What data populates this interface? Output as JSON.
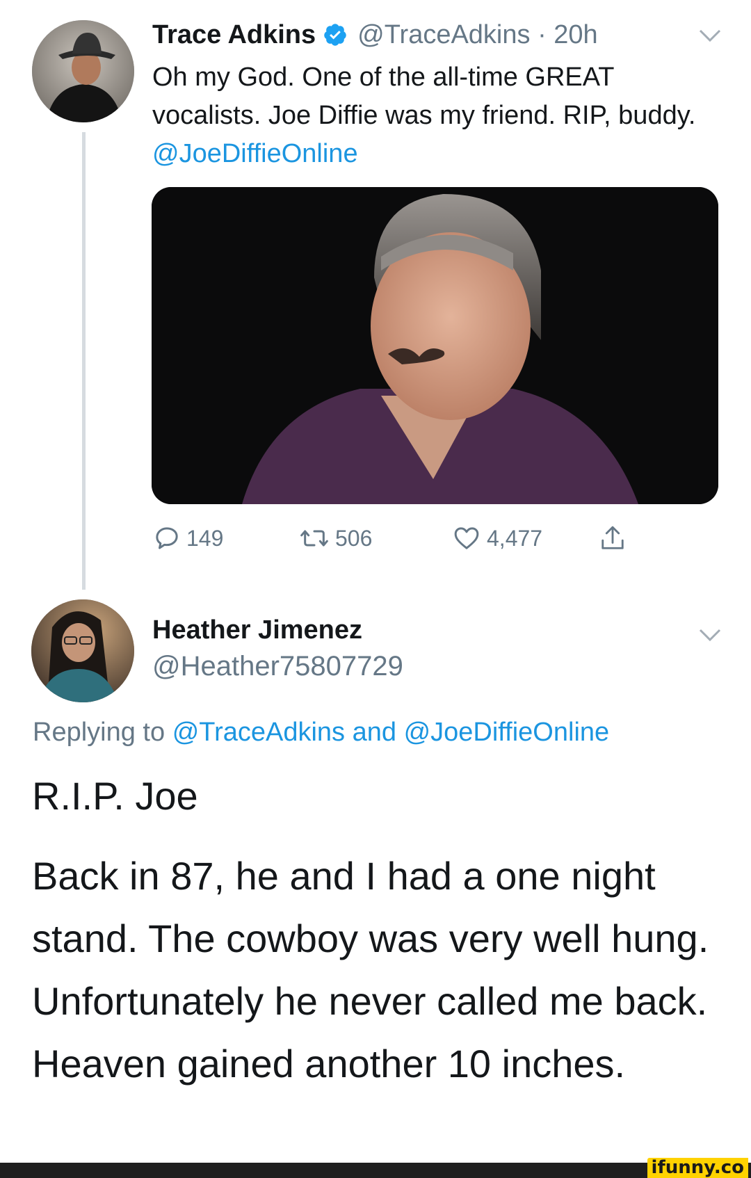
{
  "tweet": {
    "author_name": "Trace Adkins",
    "handle_time": "@TraceAdkins · 20h",
    "text_plain": "Oh my God. One of the all-time GREAT vocalists. Joe Diffie was my friend. RIP, buddy.",
    "text_mention": "@JoeDiffieOnline",
    "reply_count": "149",
    "retweet_count": "506",
    "like_count": "4,477"
  },
  "reply": {
    "author_name": "Heather Jimenez",
    "handle": "@Heather75807729",
    "replying_prefix": "Replying to",
    "replying_mention_1": "@TraceAdkins",
    "replying_and": "and",
    "replying_mention_2": "@JoeDiffieOnline",
    "line1": "R.I.P. Joe",
    "story": "Back in 87, he and I had a one night stand.  The cowboy was very well hung.  Unfortunately he never called me back.  Heaven gained another 10 inches."
  },
  "watermark": "ifunny.co",
  "colors": {
    "link": "#1b95e0",
    "secondary_text": "#657786",
    "primary_text": "#14171a",
    "thread_line": "#d6dbe0"
  },
  "icons": [
    "verified-badge-icon",
    "chevron-down-icon",
    "reply-icon",
    "retweet-icon",
    "like-icon",
    "share-icon"
  ]
}
